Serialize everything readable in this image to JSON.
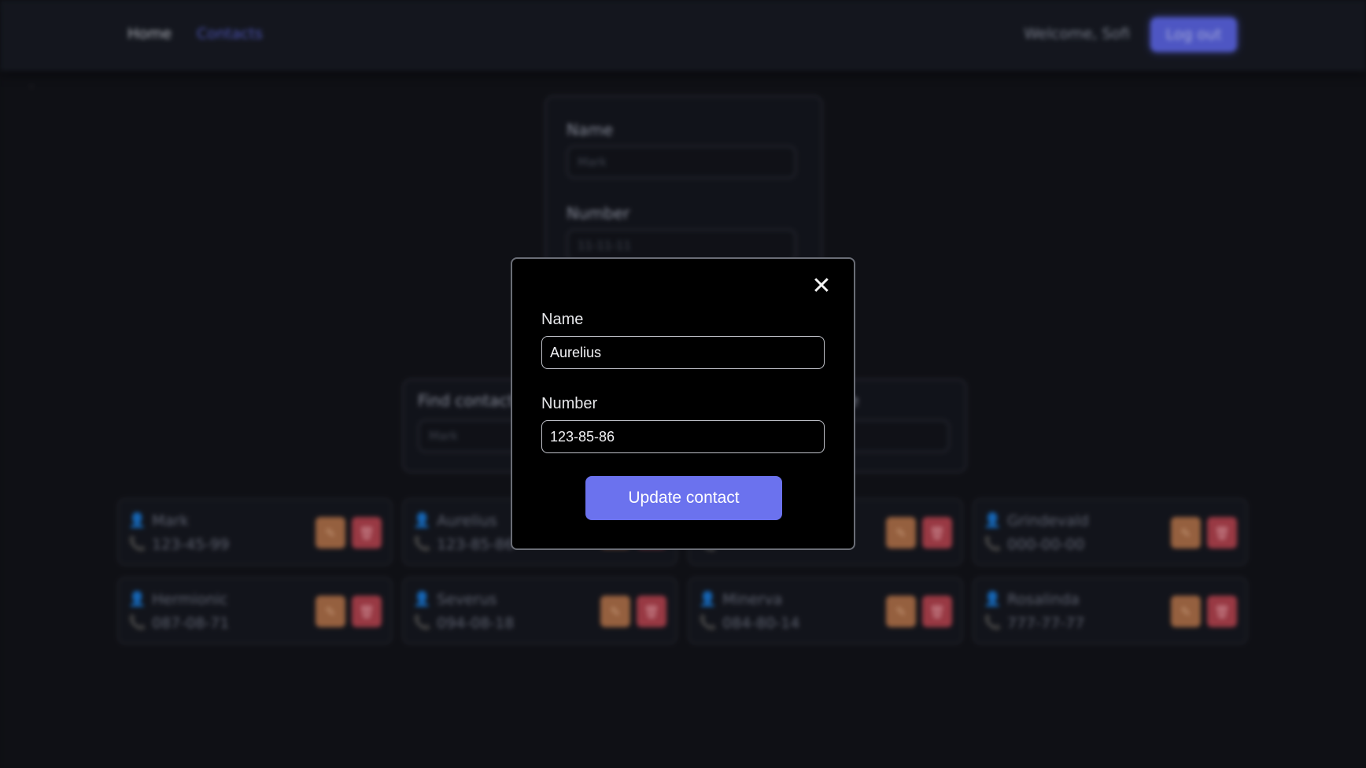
{
  "nav": {
    "home": "Home",
    "contacts": "Contacts",
    "welcome": "Welcome, Sofi",
    "logout": "Log out"
  },
  "add_form": {
    "name_label": "Name",
    "name_placeholder": "Mark",
    "number_label": "Number",
    "number_placeholder": "11-11-11"
  },
  "filters": {
    "find_label": "Find contact",
    "find_placeholder": "Mark",
    "sort_label_fragment": "e"
  },
  "contacts": [
    {
      "name": "Mark",
      "number": "123-45-99"
    },
    {
      "name": "Aurelius",
      "number": "123-85-86"
    },
    {
      "name": "",
      "number": ""
    },
    {
      "name": "Grindevald",
      "number": "000-00-00"
    },
    {
      "name": "Hermionic",
      "number": "087-08-71"
    },
    {
      "name": "Severus",
      "number": "094-08-18"
    },
    {
      "name": "Minerva",
      "number": "084-80-14"
    },
    {
      "name": "Rosalinda",
      "number": "777-77-77"
    }
  ],
  "modal": {
    "name_label": "Name",
    "name_value": "Aurelius",
    "number_label": "Number",
    "number_value": "123-85-86",
    "submit_label": "Update contact",
    "close_icon": "✕"
  }
}
